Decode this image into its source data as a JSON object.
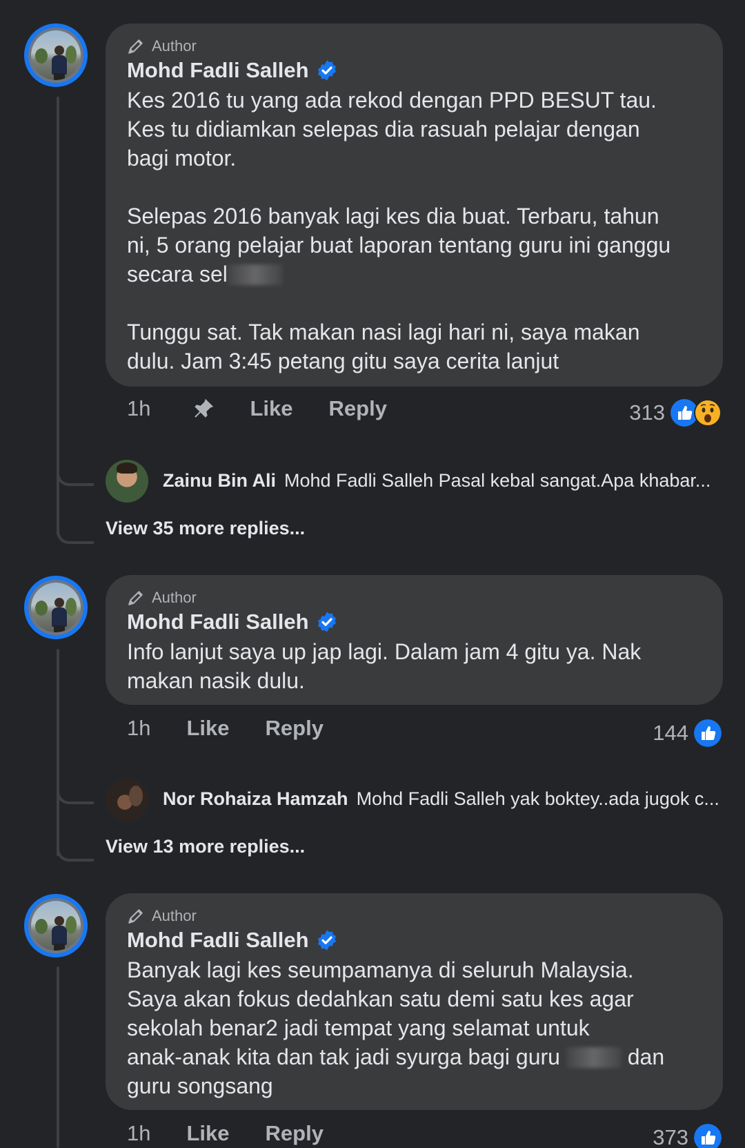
{
  "comments": [
    {
      "badge": "Author",
      "name": "Mohd Fadli Salleh",
      "text_a": "Kes 2016 tu yang ada rekod dengan PPD BESUT tau.\nKes tu didiamkan selepas dia rasuah pelajar dengan\nbagi motor.\n\nSelepas 2016 banyak lagi kes dia buat. Terbaru, tahun\nni, 5 orang pelajar buat laporan tentang guru ini ganggu\nsecara sel",
      "text_b": "\n\nTunggu sat. Tak makan nasi lagi hari ni, saya makan\ndulu. Jam 3:45 petang gitu saya cerita lanjut",
      "time": "1h",
      "like": "Like",
      "reply": "Reply",
      "reaction_count": "313",
      "reply_preview": {
        "name": "Zainu Bin Ali",
        "text": "Mohd Fadli Salleh Pasal kebal sangat.Apa khabar..."
      },
      "more_replies": "View 35 more replies..."
    },
    {
      "badge": "Author",
      "name": "Mohd Fadli Salleh",
      "text": "Info lanjut saya up jap lagi. Dalam jam 4 gitu ya. Nak\nmakan nasik dulu.",
      "time": "1h",
      "like": "Like",
      "reply": "Reply",
      "reaction_count": "144",
      "reply_preview": {
        "name": "Nor Rohaiza Hamzah",
        "text": "Mohd Fadli Salleh yak boktey..ada jugok c..."
      },
      "more_replies": "View 13 more replies..."
    },
    {
      "badge": "Author",
      "name": "Mohd Fadli Salleh",
      "text_a": "Banyak lagi kes seumpamanya di seluruh Malaysia.\nSaya akan fokus dedahkan satu demi satu kes agar\nsekolah benar2 jadi tempat yang selamat untuk\nanak-anak kita dan tak jadi syurga bagi guru ",
      "text_b": " dan\nguru songsang",
      "time": "1h",
      "like": "Like",
      "reply": "Reply",
      "reaction_count": "373"
    }
  ],
  "colors": {
    "accent": "#1877f2",
    "bubble": "#3a3b3c",
    "background": "#232427",
    "secondary_text": "#b0b3b8"
  },
  "icons": [
    "pencil-icon",
    "verified-badge-icon",
    "pin-icon",
    "like-reaction-icon",
    "wow-reaction-icon"
  ]
}
